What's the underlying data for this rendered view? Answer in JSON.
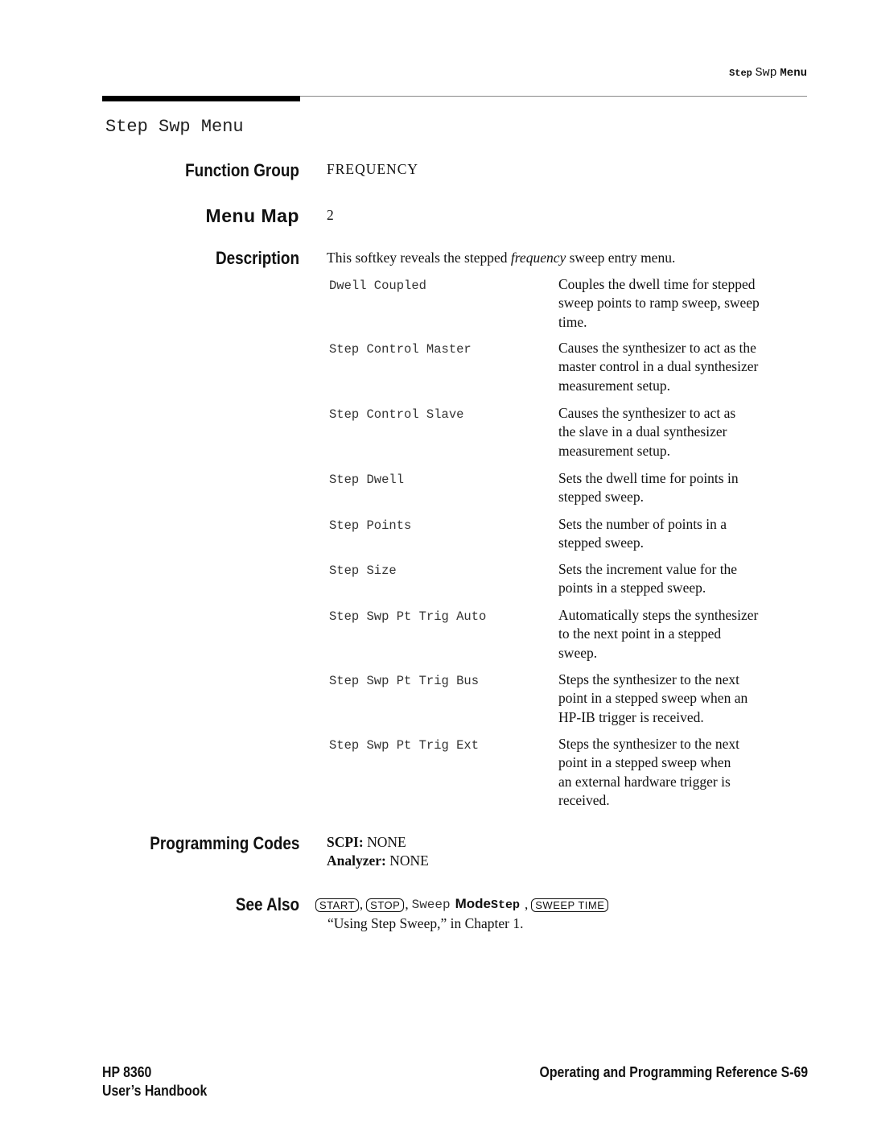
{
  "running_header": {
    "step": "Step",
    "swp": "Swp",
    "menu": "Menu"
  },
  "page_title": "Step Swp Menu",
  "sections": {
    "function_group": {
      "label": "Function Group",
      "value": "FREQUENCY"
    },
    "menu_map": {
      "label": "Menu Map",
      "value": "2"
    },
    "description": {
      "label": "Description",
      "intro_before": "This softkey reveals the stepped",
      "intro_italic": "frequency",
      "intro_after": "sweep entry menu."
    },
    "programming_codes": {
      "label": "Programming Codes",
      "scpi_label": "SCPI:",
      "scpi_value": "NONE",
      "analyzer_label": "Analyzer:",
      "analyzer_value": "NONE"
    },
    "see_also": {
      "label": "See Also",
      "key_start": "START",
      "key_stop": "STOP",
      "sweep_mono": "Sweep",
      "mode_bold": "Mode",
      "step_monobold": "Step",
      "key_sweep_time": "SWEEP TIME",
      "separator": ",",
      "reference": "“Using Step Sweep,” in Chapter 1."
    }
  },
  "softkeys": [
    {
      "name": "Dwell Coupled",
      "lines": [
        "Couples the dwell time for stepped",
        "sweep points to ramp sweep, sweep",
        "time."
      ]
    },
    {
      "name": "Step Control Master",
      "lines": [
        "Causes the synthesizer to act as the",
        "master control in a dual synthesizer",
        "measurement setup."
      ]
    },
    {
      "name": "Step Control Slave",
      "lines": [
        "Causes the synthesizer to act as",
        "the slave in a dual synthesizer",
        "measurement setup."
      ]
    },
    {
      "name": "Step Dwell",
      "lines": [
        "Sets the dwell time for points in",
        "stepped sweep."
      ]
    },
    {
      "name": "Step Points",
      "lines": [
        "Sets the number of points in a",
        "stepped sweep."
      ]
    },
    {
      "name": "Step Size",
      "lines": [
        "Sets the increment value for the",
        "points in a stepped sweep."
      ]
    },
    {
      "name": "Step Swp Pt Trig Auto",
      "lines": [
        "Automatically steps the synthesizer",
        "to the next point in a stepped",
        "sweep."
      ]
    },
    {
      "name": "Step Swp Pt Trig Bus",
      "lines": [
        "Steps the synthesizer to the next",
        "point in a stepped sweep when an",
        "HP-IB trigger is received."
      ]
    },
    {
      "name": "Step Swp Pt Trig Ext",
      "lines": [
        "Steps the synthesizer to the next",
        "point in a stepped sweep when",
        "an external hardware trigger is",
        "received."
      ]
    }
  ],
  "footer": {
    "model": "HP 8360",
    "book": "User’s Handbook",
    "reference": "Operating and Programming Reference",
    "page": "S-69"
  }
}
